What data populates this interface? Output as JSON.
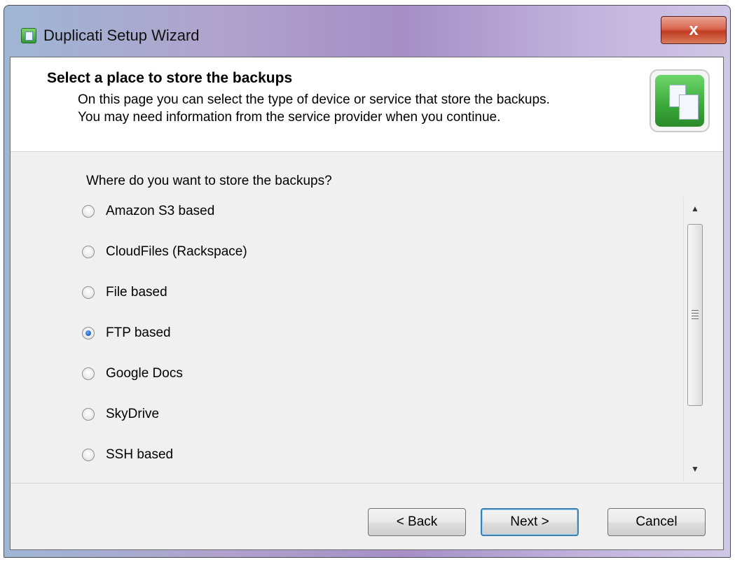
{
  "window": {
    "title": "Duplicati Setup Wizard",
    "close_label": "x"
  },
  "header": {
    "title": "Select a place to store the backups",
    "desc_line1": "On this page you can select the type of device or service that store the backups.",
    "desc_line2": "You may need information from the service provider when you continue."
  },
  "main": {
    "question": "Where do you want to store the backups?",
    "options": [
      {
        "label": "Amazon S3 based",
        "selected": false
      },
      {
        "label": "CloudFiles (Rackspace)",
        "selected": false
      },
      {
        "label": "File based",
        "selected": false
      },
      {
        "label": "FTP based",
        "selected": true
      },
      {
        "label": "Google Docs",
        "selected": false
      },
      {
        "label": "SkyDrive",
        "selected": false
      },
      {
        "label": "SSH based",
        "selected": false
      }
    ]
  },
  "footer": {
    "back_label": "< Back",
    "next_label": "Next >",
    "cancel_label": "Cancel"
  },
  "colors": {
    "accent": "#3c7fb1",
    "selected_radio": "#1f5fbf",
    "close_button": "#c23c22"
  },
  "icons": [
    "app-icon",
    "wizard-documents-icon",
    "scroll-up-icon",
    "scroll-down-icon"
  ]
}
